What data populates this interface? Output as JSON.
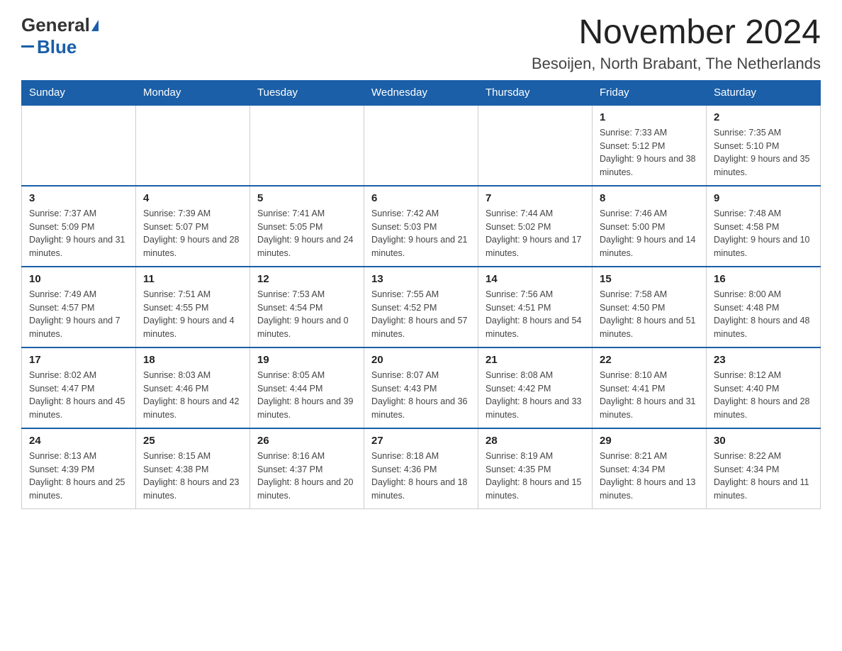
{
  "header": {
    "logo_general": "General",
    "logo_blue": "Blue",
    "month_title": "November 2024",
    "location": "Besoijen, North Brabant, The Netherlands"
  },
  "days_of_week": [
    "Sunday",
    "Monday",
    "Tuesday",
    "Wednesday",
    "Thursday",
    "Friday",
    "Saturday"
  ],
  "weeks": [
    [
      {
        "day": "",
        "info": ""
      },
      {
        "day": "",
        "info": ""
      },
      {
        "day": "",
        "info": ""
      },
      {
        "day": "",
        "info": ""
      },
      {
        "day": "",
        "info": ""
      },
      {
        "day": "1",
        "info": "Sunrise: 7:33 AM\nSunset: 5:12 PM\nDaylight: 9 hours and 38 minutes."
      },
      {
        "day": "2",
        "info": "Sunrise: 7:35 AM\nSunset: 5:10 PM\nDaylight: 9 hours and 35 minutes."
      }
    ],
    [
      {
        "day": "3",
        "info": "Sunrise: 7:37 AM\nSunset: 5:09 PM\nDaylight: 9 hours and 31 minutes."
      },
      {
        "day": "4",
        "info": "Sunrise: 7:39 AM\nSunset: 5:07 PM\nDaylight: 9 hours and 28 minutes."
      },
      {
        "day": "5",
        "info": "Sunrise: 7:41 AM\nSunset: 5:05 PM\nDaylight: 9 hours and 24 minutes."
      },
      {
        "day": "6",
        "info": "Sunrise: 7:42 AM\nSunset: 5:03 PM\nDaylight: 9 hours and 21 minutes."
      },
      {
        "day": "7",
        "info": "Sunrise: 7:44 AM\nSunset: 5:02 PM\nDaylight: 9 hours and 17 minutes."
      },
      {
        "day": "8",
        "info": "Sunrise: 7:46 AM\nSunset: 5:00 PM\nDaylight: 9 hours and 14 minutes."
      },
      {
        "day": "9",
        "info": "Sunrise: 7:48 AM\nSunset: 4:58 PM\nDaylight: 9 hours and 10 minutes."
      }
    ],
    [
      {
        "day": "10",
        "info": "Sunrise: 7:49 AM\nSunset: 4:57 PM\nDaylight: 9 hours and 7 minutes."
      },
      {
        "day": "11",
        "info": "Sunrise: 7:51 AM\nSunset: 4:55 PM\nDaylight: 9 hours and 4 minutes."
      },
      {
        "day": "12",
        "info": "Sunrise: 7:53 AM\nSunset: 4:54 PM\nDaylight: 9 hours and 0 minutes."
      },
      {
        "day": "13",
        "info": "Sunrise: 7:55 AM\nSunset: 4:52 PM\nDaylight: 8 hours and 57 minutes."
      },
      {
        "day": "14",
        "info": "Sunrise: 7:56 AM\nSunset: 4:51 PM\nDaylight: 8 hours and 54 minutes."
      },
      {
        "day": "15",
        "info": "Sunrise: 7:58 AM\nSunset: 4:50 PM\nDaylight: 8 hours and 51 minutes."
      },
      {
        "day": "16",
        "info": "Sunrise: 8:00 AM\nSunset: 4:48 PM\nDaylight: 8 hours and 48 minutes."
      }
    ],
    [
      {
        "day": "17",
        "info": "Sunrise: 8:02 AM\nSunset: 4:47 PM\nDaylight: 8 hours and 45 minutes."
      },
      {
        "day": "18",
        "info": "Sunrise: 8:03 AM\nSunset: 4:46 PM\nDaylight: 8 hours and 42 minutes."
      },
      {
        "day": "19",
        "info": "Sunrise: 8:05 AM\nSunset: 4:44 PM\nDaylight: 8 hours and 39 minutes."
      },
      {
        "day": "20",
        "info": "Sunrise: 8:07 AM\nSunset: 4:43 PM\nDaylight: 8 hours and 36 minutes."
      },
      {
        "day": "21",
        "info": "Sunrise: 8:08 AM\nSunset: 4:42 PM\nDaylight: 8 hours and 33 minutes."
      },
      {
        "day": "22",
        "info": "Sunrise: 8:10 AM\nSunset: 4:41 PM\nDaylight: 8 hours and 31 minutes."
      },
      {
        "day": "23",
        "info": "Sunrise: 8:12 AM\nSunset: 4:40 PM\nDaylight: 8 hours and 28 minutes."
      }
    ],
    [
      {
        "day": "24",
        "info": "Sunrise: 8:13 AM\nSunset: 4:39 PM\nDaylight: 8 hours and 25 minutes."
      },
      {
        "day": "25",
        "info": "Sunrise: 8:15 AM\nSunset: 4:38 PM\nDaylight: 8 hours and 23 minutes."
      },
      {
        "day": "26",
        "info": "Sunrise: 8:16 AM\nSunset: 4:37 PM\nDaylight: 8 hours and 20 minutes."
      },
      {
        "day": "27",
        "info": "Sunrise: 8:18 AM\nSunset: 4:36 PM\nDaylight: 8 hours and 18 minutes."
      },
      {
        "day": "28",
        "info": "Sunrise: 8:19 AM\nSunset: 4:35 PM\nDaylight: 8 hours and 15 minutes."
      },
      {
        "day": "29",
        "info": "Sunrise: 8:21 AM\nSunset: 4:34 PM\nDaylight: 8 hours and 13 minutes."
      },
      {
        "day": "30",
        "info": "Sunrise: 8:22 AM\nSunset: 4:34 PM\nDaylight: 8 hours and 11 minutes."
      }
    ]
  ]
}
